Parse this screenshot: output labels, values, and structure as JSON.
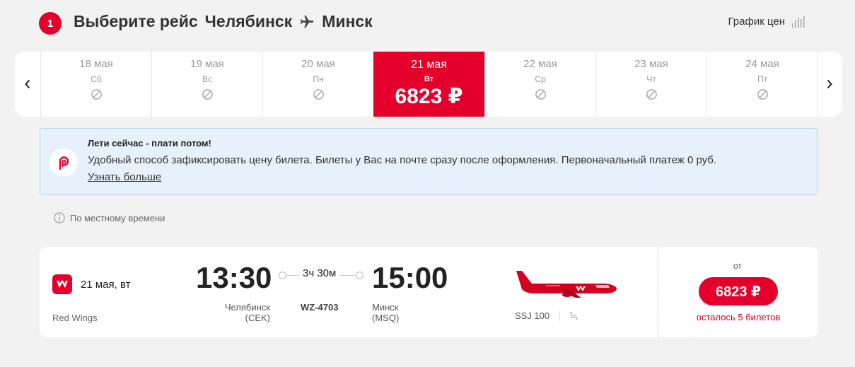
{
  "header": {
    "step": "1",
    "title_prefix": "Выберите рейс",
    "origin": "Челябинск",
    "destination": "Минск",
    "price_graph_label": "График цен"
  },
  "dates": {
    "prev_icon": "chevron-left-icon",
    "next_icon": "chevron-right-icon",
    "days": [
      {
        "date": "18 мая",
        "weekday": "Сб",
        "available": false
      },
      {
        "date": "19 мая",
        "weekday": "Вс",
        "available": false
      },
      {
        "date": "20 мая",
        "weekday": "Пн",
        "available": false
      },
      {
        "date": "21 мая",
        "weekday": "Вт",
        "available": true,
        "price": "6823 ₽",
        "selected": true
      },
      {
        "date": "22 мая",
        "weekday": "Ср",
        "available": false
      },
      {
        "date": "23 мая",
        "weekday": "Чт",
        "available": false
      },
      {
        "date": "24 мая",
        "weekday": "Пт",
        "available": false
      }
    ]
  },
  "promo": {
    "title": "Лети сейчас - плати потом!",
    "text": "Удобный способ зафиксировать цену билета. Билеты у Вас на почте сразу после оформления. Первоначальный платеж 0 руб.",
    "link": "Узнать больше"
  },
  "notice": {
    "local_time": "По местному времени"
  },
  "flight": {
    "date": "21 мая, вт",
    "airline": "Red Wings",
    "departure_time": "13:30",
    "arrival_time": "15:00",
    "duration": "3ч 30м",
    "flight_number": "WZ-4703",
    "departure_city": "Челябинск",
    "departure_code": "(CEK)",
    "arrival_city": "Минск",
    "arrival_code": "(MSQ)",
    "aircraft": "SSJ 100",
    "price_from": "от",
    "price": "6823 ₽",
    "seats_left": "осталось 5 билетов"
  },
  "colors": {
    "accent": "#e4002b",
    "background": "#f2f2f2",
    "promo_bg": "#e7f1fb",
    "muted": "#999999"
  }
}
